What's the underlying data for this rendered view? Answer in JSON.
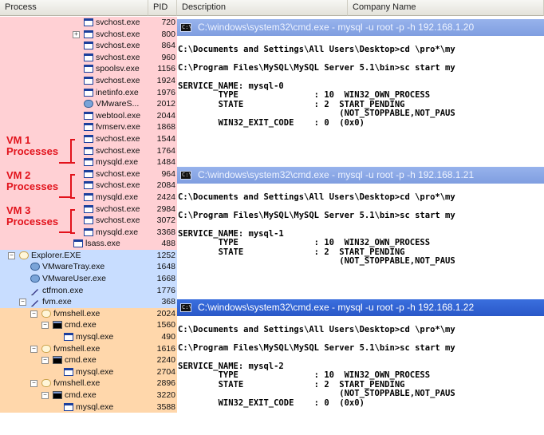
{
  "columns": {
    "process": "Process",
    "pid": "PID",
    "description": "Description",
    "company": "Company Name"
  },
  "processes": [
    {
      "name": "svchost.exe",
      "pid": "720",
      "indent": 105,
      "color": "svc",
      "icon": "window"
    },
    {
      "name": "svchost.exe",
      "pid": "800",
      "indent": 105,
      "color": "svc",
      "icon": "window",
      "toggle": "+"
    },
    {
      "name": "svchost.exe",
      "pid": "864",
      "indent": 105,
      "color": "svc",
      "icon": "window"
    },
    {
      "name": "svchost.exe",
      "pid": "960",
      "indent": 105,
      "color": "svc",
      "icon": "window"
    },
    {
      "name": "spoolsv.exe",
      "pid": "1156",
      "indent": 105,
      "color": "svc",
      "icon": "window"
    },
    {
      "name": "svchost.exe",
      "pid": "1924",
      "indent": 105,
      "color": "svc",
      "icon": "window"
    },
    {
      "name": "inetinfo.exe",
      "pid": "1976",
      "indent": 105,
      "color": "svc",
      "icon": "window"
    },
    {
      "name": "VMwareS...",
      "pid": "2012",
      "indent": 105,
      "color": "svc",
      "icon": "tray"
    },
    {
      "name": "webtool.exe",
      "pid": "2044",
      "indent": 105,
      "color": "svc",
      "icon": "window"
    },
    {
      "name": "fvmserv.exe",
      "pid": "1868",
      "indent": 105,
      "color": "svc",
      "icon": "window"
    },
    {
      "name": "svchost.exe",
      "pid": "1544",
      "indent": 105,
      "color": "svc",
      "icon": "window"
    },
    {
      "name": "svchost.exe",
      "pid": "1764",
      "indent": 105,
      "color": "svc",
      "icon": "window"
    },
    {
      "name": "mysqld.exe",
      "pid": "1484",
      "indent": 105,
      "color": "svc",
      "icon": "window"
    },
    {
      "name": "svchost.exe",
      "pid": "964",
      "indent": 105,
      "color": "svc",
      "icon": "window"
    },
    {
      "name": "svchost.exe",
      "pid": "2084",
      "indent": 105,
      "color": "svc",
      "icon": "window"
    },
    {
      "name": "mysqld.exe",
      "pid": "2424",
      "indent": 105,
      "color": "svc",
      "icon": "window"
    },
    {
      "name": "svchost.exe",
      "pid": "2984",
      "indent": 105,
      "color": "svc",
      "icon": "window"
    },
    {
      "name": "svchost.exe",
      "pid": "3072",
      "indent": 105,
      "color": "svc",
      "icon": "window"
    },
    {
      "name": "mysqld.exe",
      "pid": "3368",
      "indent": 105,
      "color": "svc",
      "icon": "window"
    },
    {
      "name": "lsass.exe",
      "pid": "488",
      "indent": 92,
      "color": "svc",
      "icon": "window"
    },
    {
      "name": "Explorer.EXE",
      "pid": "1252",
      "indent": 24,
      "color": "usr",
      "icon": "globe",
      "toggle": "-"
    },
    {
      "name": "VMwareTray.exe",
      "pid": "1648",
      "indent": 38,
      "color": "usr",
      "icon": "tray"
    },
    {
      "name": "VMwareUser.exe",
      "pid": "1668",
      "indent": 38,
      "color": "usr",
      "icon": "tray"
    },
    {
      "name": "ctfmon.exe",
      "pid": "1776",
      "indent": 38,
      "color": "usr",
      "icon": "pen"
    },
    {
      "name": "fvm.exe",
      "pid": "368",
      "indent": 38,
      "color": "usr",
      "icon": "pen",
      "toggle": "-"
    },
    {
      "name": "fvmshell.exe",
      "pid": "2024",
      "indent": 52,
      "color": "fvm",
      "icon": "globe",
      "toggle": "-"
    },
    {
      "name": "cmd.exe",
      "pid": "1560",
      "indent": 66,
      "color": "fvm",
      "icon": "cmd",
      "toggle": "-"
    },
    {
      "name": "mysql.exe",
      "pid": "490",
      "indent": 80,
      "color": "fvm",
      "icon": "window"
    },
    {
      "name": "fvmshell.exe",
      "pid": "1616",
      "indent": 52,
      "color": "fvm",
      "icon": "globe",
      "toggle": "-"
    },
    {
      "name": "cmd.exe",
      "pid": "2240",
      "indent": 66,
      "color": "fvm",
      "icon": "cmd",
      "toggle": "-"
    },
    {
      "name": "mysql.exe",
      "pid": "2704",
      "indent": 80,
      "color": "fvm",
      "icon": "window"
    },
    {
      "name": "fvmshell.exe",
      "pid": "2896",
      "indent": 52,
      "color": "fvm",
      "icon": "globe",
      "toggle": "-"
    },
    {
      "name": "cmd.exe",
      "pid": "3220",
      "indent": 66,
      "color": "fvm",
      "icon": "cmd",
      "toggle": "-"
    },
    {
      "name": "mysql.exe",
      "pid": "3588",
      "indent": 80,
      "color": "fvm",
      "icon": "window"
    }
  ],
  "annotations": [
    {
      "line1": "VM 1",
      "line2": "Processes"
    },
    {
      "line1": "VM 2",
      "line2": "Processes"
    },
    {
      "line1": "VM 3",
      "line2": "Processes"
    }
  ],
  "cmd_windows": [
    {
      "title": "C:\\windows\\system32\\cmd.exe - mysql -u root -p -h 192.168.1.20",
      "active": false,
      "lines": [
        "",
        "C:\\Documents and Settings\\All Users\\Desktop>cd \\pro*\\my",
        "",
        "C:\\Program Files\\MySQL\\MySQL Server 5.1\\bin>sc start my",
        "",
        "SERVICE_NAME: mysql-0",
        "        TYPE               : 10  WIN32_OWN_PROCESS",
        "        STATE              : 2  START_PENDING",
        "                                (NOT_STOPPABLE,NOT_PAUS",
        "        WIN32_EXIT_CODE    : 0  (0x0)"
      ]
    },
    {
      "title": "C:\\windows\\system32\\cmd.exe - mysql -u root -p -h 192.168.1.21",
      "active": false,
      "lines": [
        "",
        "C:\\Documents and Settings\\All Users\\Desktop>cd \\pro*\\my",
        "",
        "C:\\Program Files\\MySQL\\MySQL Server 5.1\\bin>sc start my",
        "",
        "SERVICE_NAME: mysql-1",
        "        TYPE               : 10  WIN32_OWN_PROCESS",
        "        STATE              : 2  START_PENDING",
        "                                (NOT_STOPPABLE,NOT_PAUS"
      ]
    },
    {
      "title": "C:\\windows\\system32\\cmd.exe - mysql -u root -p -h 192.168.1.22",
      "active": true,
      "lines": [
        "",
        "C:\\Documents and Settings\\All Users\\Desktop>cd \\pro*\\my",
        "",
        "C:\\Program Files\\MySQL\\MySQL Server 5.1\\bin>sc start my",
        "",
        "SERVICE_NAME: mysql-2",
        "        TYPE               : 10  WIN32_OWN_PROCESS",
        "        STATE              : 2  START_PENDING",
        "                                (NOT_STOPPABLE,NOT_PAUS",
        "        WIN32_EXIT_CODE    : 0  (0x0)"
      ]
    }
  ]
}
